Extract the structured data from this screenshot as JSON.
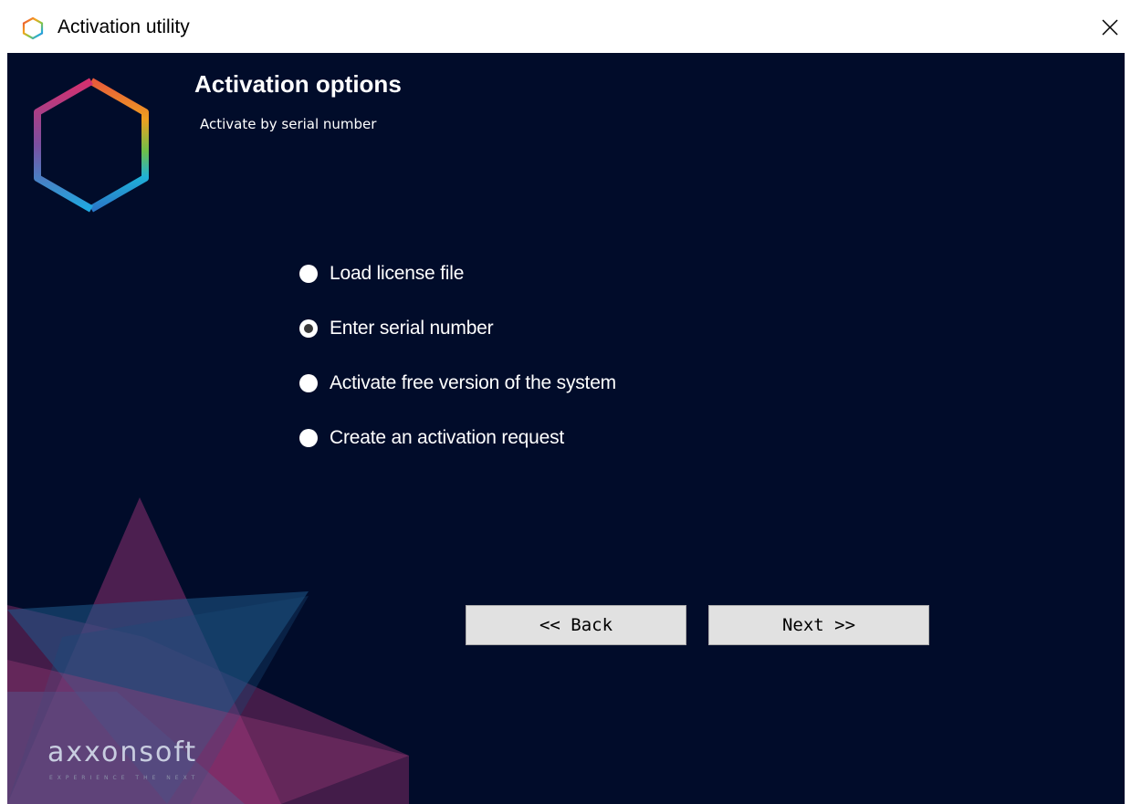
{
  "window": {
    "title": "Activation utility",
    "close_glyph": "✕"
  },
  "header": {
    "title": "Activation options",
    "subtitle": "Activate by serial number"
  },
  "options": [
    {
      "label": "Load license file",
      "checked": false
    },
    {
      "label": "Enter serial number",
      "checked": true
    },
    {
      "label": "Activate free version of the system",
      "checked": false
    },
    {
      "label": "Create an activation request",
      "checked": false
    }
  ],
  "buttons": {
    "back_label": "<< Back",
    "next_label": "Next >>"
  },
  "brand": {
    "logo_text": "axxonsoft",
    "tagline": "EXPERIENCE THE NEXT"
  },
  "colors": {
    "background": "#010c2a",
    "button_bg": "#e1e1e1",
    "hex_gradient": [
      "#e8443a",
      "#f4a51c",
      "#8cc63f",
      "#1fa9e1",
      "#7b4fa0",
      "#d6306e"
    ]
  },
  "icons": {
    "title_icon": "hexagon-logo-icon",
    "close_icon": "close-icon",
    "radio_icon": "radio-icon"
  }
}
